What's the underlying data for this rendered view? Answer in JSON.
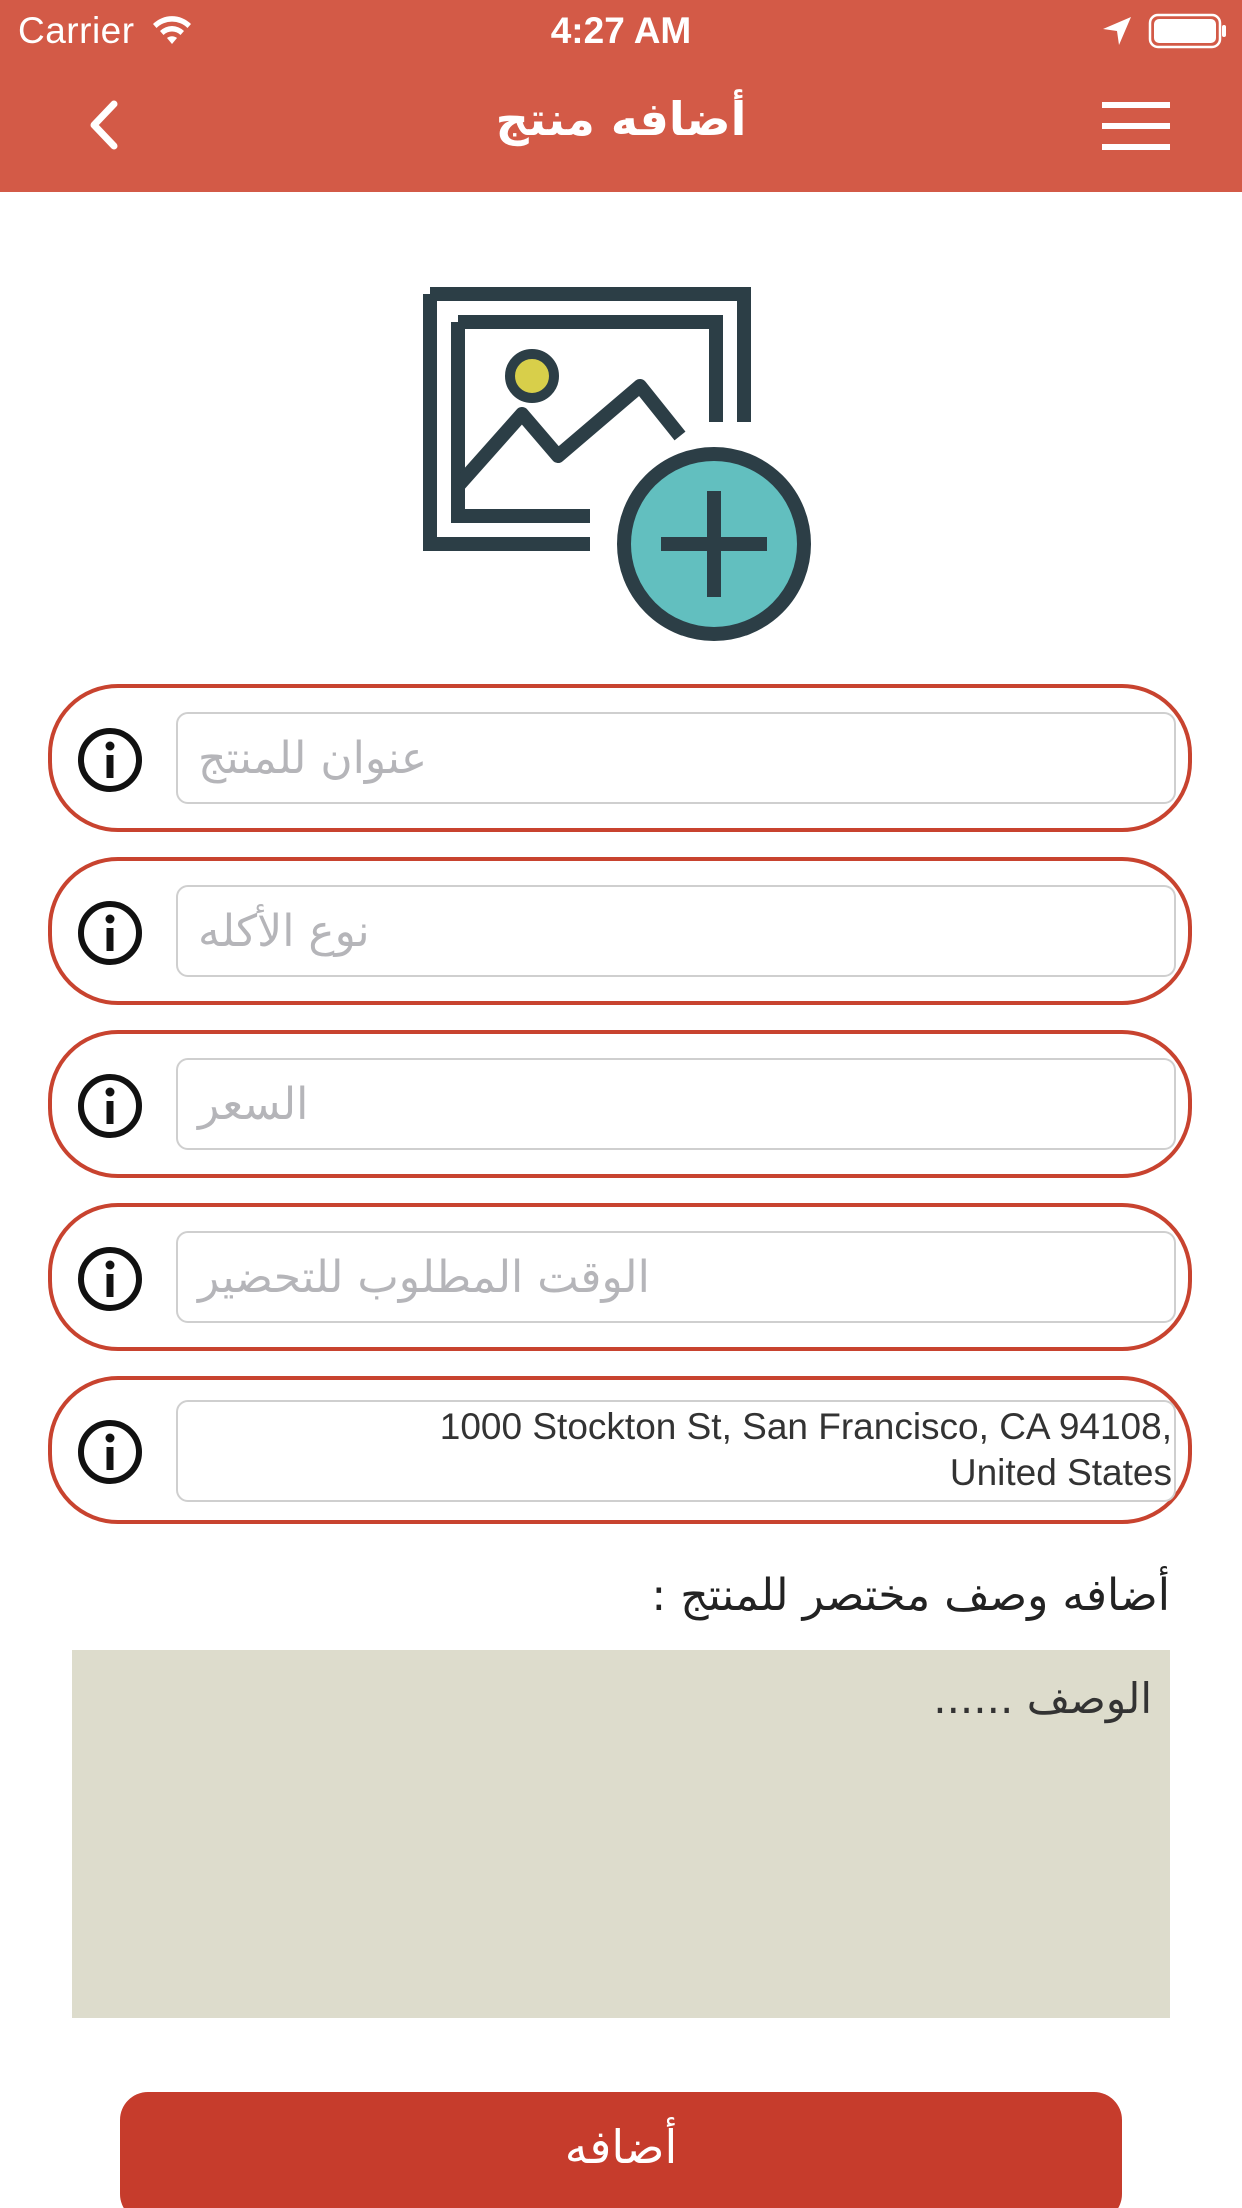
{
  "status_bar": {
    "carrier": "Carrier",
    "time": "4:27 AM"
  },
  "header": {
    "title": "أضافه منتج",
    "back_icon": "chevron-left-icon",
    "menu_icon": "hamburger-menu-icon"
  },
  "image_picker": {
    "icon": "add-image-icon"
  },
  "fields": [
    {
      "placeholder": "عنوان للمنتج"
    },
    {
      "placeholder": "نوع الأكله"
    },
    {
      "placeholder": "السعر"
    },
    {
      "placeholder": "الوقت المطلوب للتحضير"
    }
  ],
  "address": {
    "line1": "1000 Stockton St, San Francisco, CA  94108,",
    "line2": "United States"
  },
  "description": {
    "label": "أضافه وصف مختصر للمنتج :",
    "placeholder": "الوصف ......"
  },
  "submit": {
    "label": "أضافه"
  },
  "colors": {
    "header": "#d35a47",
    "field_border": "#c8432f",
    "button": "#c63c2c",
    "description_bg": "#dddccc",
    "icon_dark": "#2c3e46",
    "icon_teal": "#62bfbf",
    "icon_yellow": "#d8cf4a"
  }
}
